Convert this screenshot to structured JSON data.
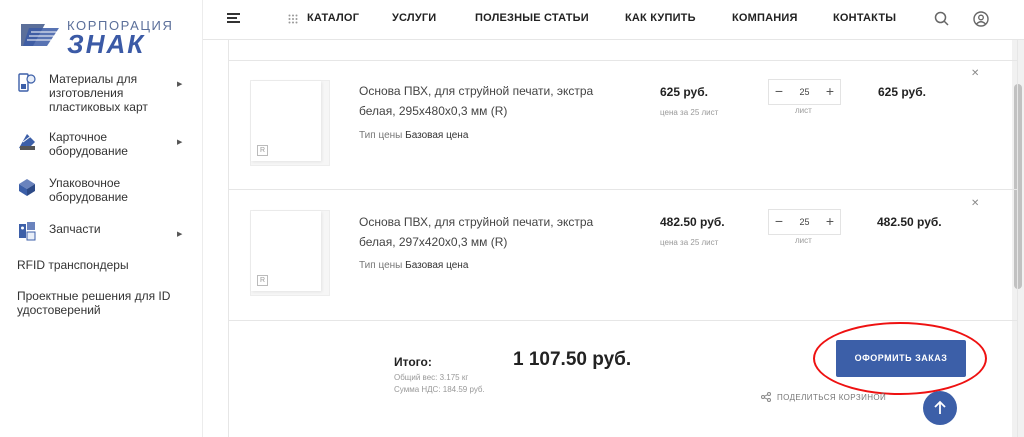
{
  "brand": {
    "small_text": "КОРПОРАЦИЯ",
    "big_text": "ЗНАК",
    "accent_color": "#3c5fa8"
  },
  "header": {
    "nav": [
      "КАТАЛОГ",
      "УСЛУГИ",
      "ПОЛЕЗНЫЕ СТАТЬИ",
      "КАК КУПИТЬ",
      "КОМПАНИЯ",
      "КОНТАКТЫ"
    ],
    "icons": [
      "menu-icon",
      "grid-dots-icon",
      "search-icon",
      "user-icon"
    ]
  },
  "sidebar": {
    "items": [
      {
        "label": "Материалы для изготовления пластиковых карт",
        "icon": "materials-icon",
        "has_submenu": true
      },
      {
        "label": "Карточное оборудование",
        "icon": "card-equipment-icon",
        "has_submenu": true
      },
      {
        "label": "Упаковочное оборудование",
        "icon": "packing-equipment-icon",
        "has_submenu": false
      },
      {
        "label": "Запчасти",
        "icon": "spare-parts-icon",
        "has_submenu": true
      }
    ],
    "plain_items": [
      "RFID транспондеры",
      "Проектные решения для ID удостоверений"
    ]
  },
  "cart": {
    "items": [
      {
        "name": "Основа ПВХ, для струйной печати, экстра белая, 295x480x0,3 мм (R)",
        "price_type_label": "Тип цены",
        "price_type_value": "Базовая цена",
        "unit_price": "625 руб.",
        "unit_note": "цена за 25 лист",
        "quantity": "25",
        "unit": "лист",
        "total": "625 руб.",
        "thumb_mark": "R"
      },
      {
        "name": "Основа ПВХ, для струйной печати, экстра белая, 297x420x0,3 мм (R)",
        "price_type_label": "Тип цены",
        "price_type_value": "Базовая цена",
        "unit_price": "482.50 руб.",
        "unit_note": "цена за 25 лист",
        "quantity": "25",
        "unit": "лист",
        "total": "482.50 руб.",
        "thumb_mark": "R"
      }
    ],
    "summary": {
      "label": "Итого:",
      "total": "1 107.50 руб.",
      "weight": "Общий вес: 3.175 кг",
      "vat": "Сумма НДС: 184.59 руб."
    },
    "order_button": "ОФОРМИТЬ ЗАКАЗ",
    "share_label": "ПОДЕЛИТЬСЯ КОРЗИНОЙ",
    "annotation_color": "#e11111"
  }
}
